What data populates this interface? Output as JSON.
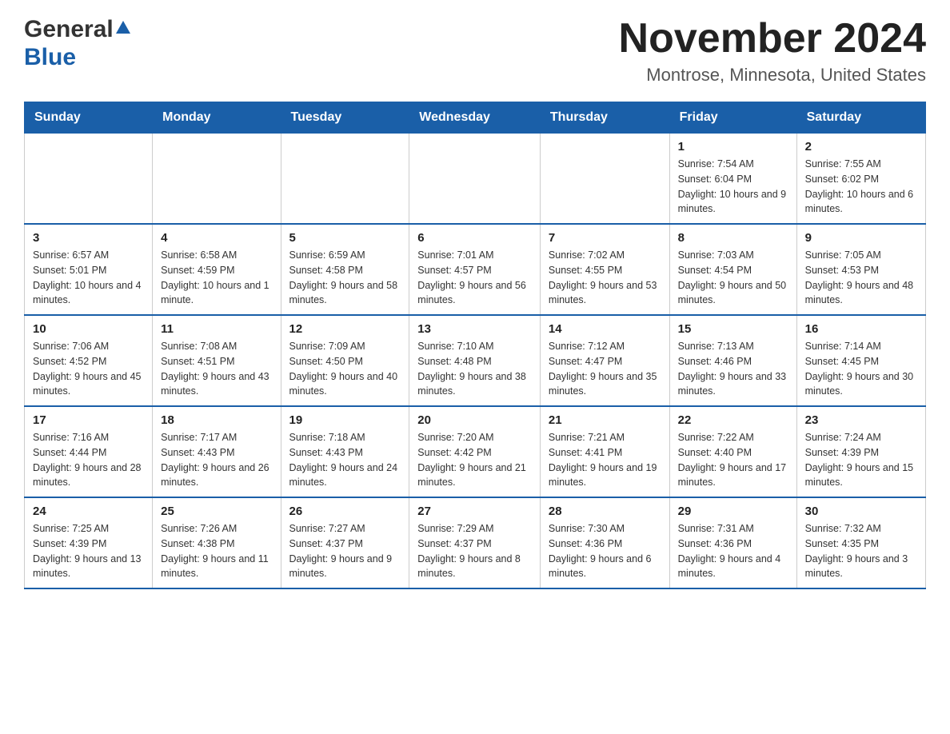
{
  "header": {
    "logo_general": "General",
    "logo_blue": "Blue",
    "month_title": "November 2024",
    "location": "Montrose, Minnesota, United States"
  },
  "weekdays": [
    "Sunday",
    "Monday",
    "Tuesday",
    "Wednesday",
    "Thursday",
    "Friday",
    "Saturday"
  ],
  "weeks": [
    [
      {
        "day": "",
        "info": ""
      },
      {
        "day": "",
        "info": ""
      },
      {
        "day": "",
        "info": ""
      },
      {
        "day": "",
        "info": ""
      },
      {
        "day": "",
        "info": ""
      },
      {
        "day": "1",
        "info": "Sunrise: 7:54 AM\nSunset: 6:04 PM\nDaylight: 10 hours and 9 minutes."
      },
      {
        "day": "2",
        "info": "Sunrise: 7:55 AM\nSunset: 6:02 PM\nDaylight: 10 hours and 6 minutes."
      }
    ],
    [
      {
        "day": "3",
        "info": "Sunrise: 6:57 AM\nSunset: 5:01 PM\nDaylight: 10 hours and 4 minutes."
      },
      {
        "day": "4",
        "info": "Sunrise: 6:58 AM\nSunset: 4:59 PM\nDaylight: 10 hours and 1 minute."
      },
      {
        "day": "5",
        "info": "Sunrise: 6:59 AM\nSunset: 4:58 PM\nDaylight: 9 hours and 58 minutes."
      },
      {
        "day": "6",
        "info": "Sunrise: 7:01 AM\nSunset: 4:57 PM\nDaylight: 9 hours and 56 minutes."
      },
      {
        "day": "7",
        "info": "Sunrise: 7:02 AM\nSunset: 4:55 PM\nDaylight: 9 hours and 53 minutes."
      },
      {
        "day": "8",
        "info": "Sunrise: 7:03 AM\nSunset: 4:54 PM\nDaylight: 9 hours and 50 minutes."
      },
      {
        "day": "9",
        "info": "Sunrise: 7:05 AM\nSunset: 4:53 PM\nDaylight: 9 hours and 48 minutes."
      }
    ],
    [
      {
        "day": "10",
        "info": "Sunrise: 7:06 AM\nSunset: 4:52 PM\nDaylight: 9 hours and 45 minutes."
      },
      {
        "day": "11",
        "info": "Sunrise: 7:08 AM\nSunset: 4:51 PM\nDaylight: 9 hours and 43 minutes."
      },
      {
        "day": "12",
        "info": "Sunrise: 7:09 AM\nSunset: 4:50 PM\nDaylight: 9 hours and 40 minutes."
      },
      {
        "day": "13",
        "info": "Sunrise: 7:10 AM\nSunset: 4:48 PM\nDaylight: 9 hours and 38 minutes."
      },
      {
        "day": "14",
        "info": "Sunrise: 7:12 AM\nSunset: 4:47 PM\nDaylight: 9 hours and 35 minutes."
      },
      {
        "day": "15",
        "info": "Sunrise: 7:13 AM\nSunset: 4:46 PM\nDaylight: 9 hours and 33 minutes."
      },
      {
        "day": "16",
        "info": "Sunrise: 7:14 AM\nSunset: 4:45 PM\nDaylight: 9 hours and 30 minutes."
      }
    ],
    [
      {
        "day": "17",
        "info": "Sunrise: 7:16 AM\nSunset: 4:44 PM\nDaylight: 9 hours and 28 minutes."
      },
      {
        "day": "18",
        "info": "Sunrise: 7:17 AM\nSunset: 4:43 PM\nDaylight: 9 hours and 26 minutes."
      },
      {
        "day": "19",
        "info": "Sunrise: 7:18 AM\nSunset: 4:43 PM\nDaylight: 9 hours and 24 minutes."
      },
      {
        "day": "20",
        "info": "Sunrise: 7:20 AM\nSunset: 4:42 PM\nDaylight: 9 hours and 21 minutes."
      },
      {
        "day": "21",
        "info": "Sunrise: 7:21 AM\nSunset: 4:41 PM\nDaylight: 9 hours and 19 minutes."
      },
      {
        "day": "22",
        "info": "Sunrise: 7:22 AM\nSunset: 4:40 PM\nDaylight: 9 hours and 17 minutes."
      },
      {
        "day": "23",
        "info": "Sunrise: 7:24 AM\nSunset: 4:39 PM\nDaylight: 9 hours and 15 minutes."
      }
    ],
    [
      {
        "day": "24",
        "info": "Sunrise: 7:25 AM\nSunset: 4:39 PM\nDaylight: 9 hours and 13 minutes."
      },
      {
        "day": "25",
        "info": "Sunrise: 7:26 AM\nSunset: 4:38 PM\nDaylight: 9 hours and 11 minutes."
      },
      {
        "day": "26",
        "info": "Sunrise: 7:27 AM\nSunset: 4:37 PM\nDaylight: 9 hours and 9 minutes."
      },
      {
        "day": "27",
        "info": "Sunrise: 7:29 AM\nSunset: 4:37 PM\nDaylight: 9 hours and 8 minutes."
      },
      {
        "day": "28",
        "info": "Sunrise: 7:30 AM\nSunset: 4:36 PM\nDaylight: 9 hours and 6 minutes."
      },
      {
        "day": "29",
        "info": "Sunrise: 7:31 AM\nSunset: 4:36 PM\nDaylight: 9 hours and 4 minutes."
      },
      {
        "day": "30",
        "info": "Sunrise: 7:32 AM\nSunset: 4:35 PM\nDaylight: 9 hours and 3 minutes."
      }
    ]
  ]
}
